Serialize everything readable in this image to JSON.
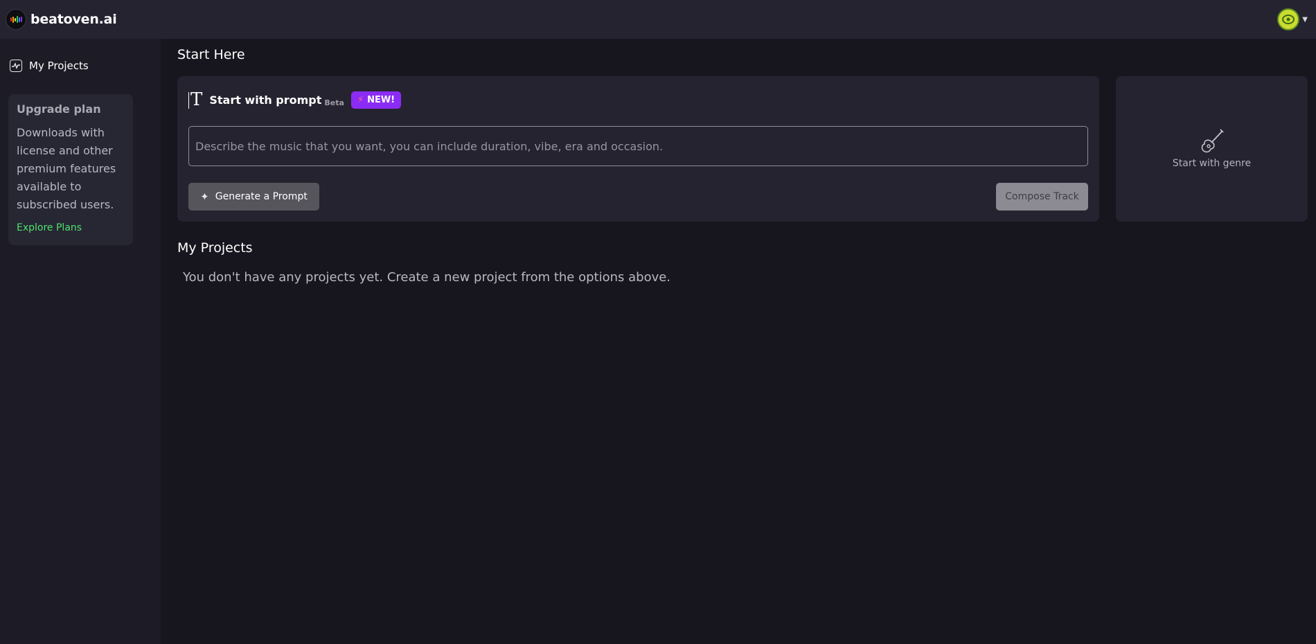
{
  "header": {
    "brand_name": "beatoven.ai",
    "logo_bar_colors": [
      "#e8352f",
      "#f5a623",
      "#f5e02a",
      "#35c759",
      "#2d8cf0",
      "#8b2cf5"
    ]
  },
  "sidebar": {
    "nav_item_label": "My Projects",
    "upgrade": {
      "title": "Upgrade plan",
      "text": "Downloads with license and other premium features available to subscribed users.",
      "link": "Explore Plans"
    }
  },
  "main": {
    "start_title": "Start Here",
    "prompt": {
      "title": "Start with prompt",
      "beta": "Beta",
      "badge": "NEW!",
      "placeholder": "Describe the music that you want, you can include duration, vibe, era and occasion.",
      "generate_label": "Generate a Prompt",
      "compose_label": "Compose Track"
    },
    "genre_label": "Start with genre",
    "projects_title": "My Projects",
    "empty_text": "You don't have any projects yet. Create a new project from the options above."
  },
  "colors": {
    "accent_link": "#4ee36b",
    "badge_purple": "#8b2cf5",
    "background": "#17161f"
  }
}
